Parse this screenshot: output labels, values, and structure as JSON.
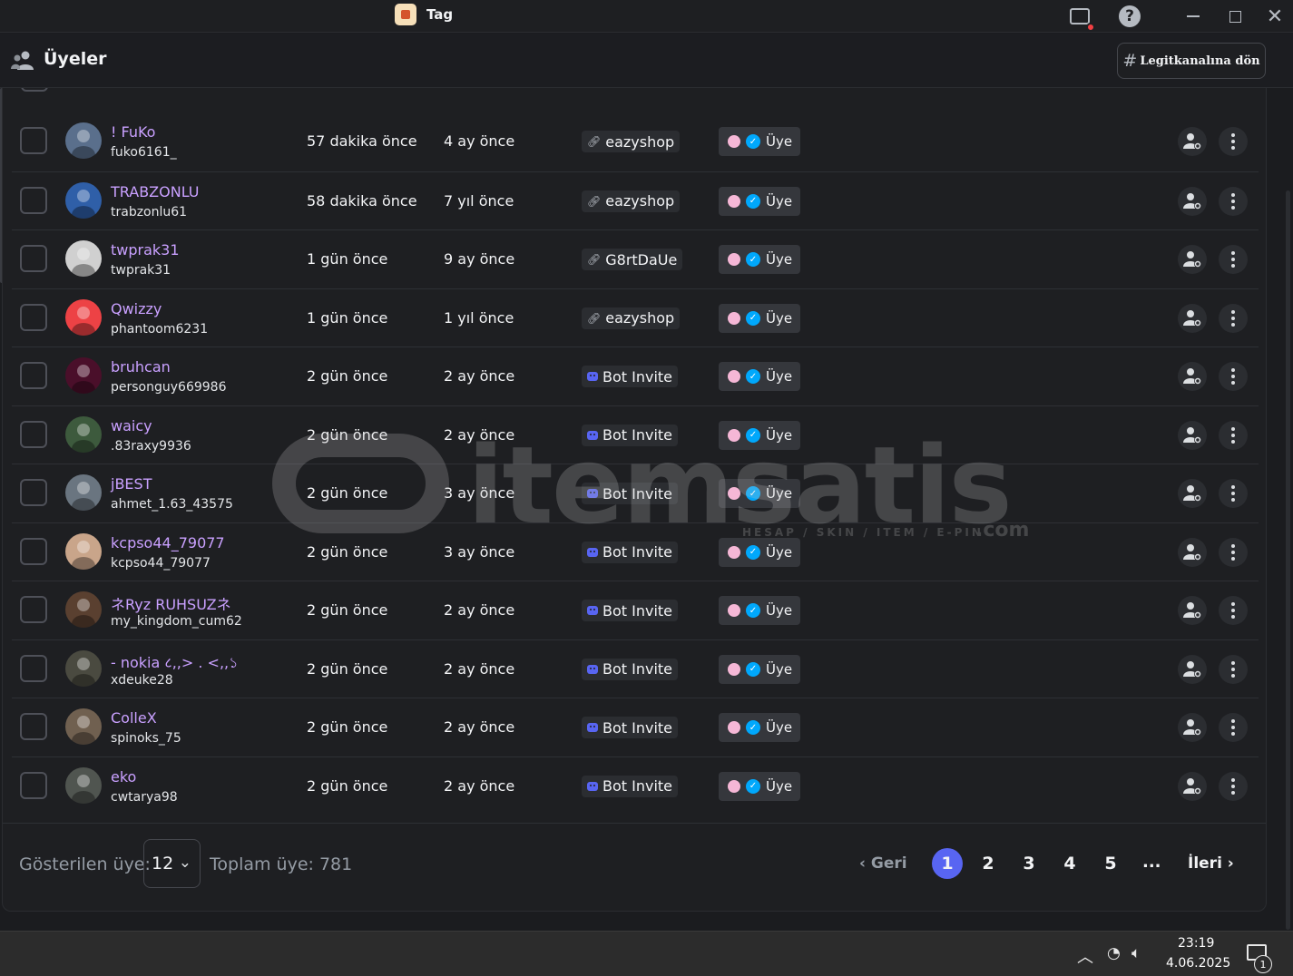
{
  "titlebar": {
    "app_title": "Tag",
    "icons": [
      "app-icon",
      "inbox-icon",
      "help-icon",
      "minimize-icon",
      "maximize-icon",
      "close-icon"
    ]
  },
  "header": {
    "title": "Üyeler",
    "icon": "members-icon",
    "back_button_hash": "#",
    "back_button_label": "Legitkanalına dön"
  },
  "table": {
    "rows": [
      {
        "display_name": "! FuKo",
        "username": "fuko6161_",
        "joined": "57 dakika önce",
        "account_age": "4 ay önce",
        "method": "eazyshop",
        "method_type": "link",
        "role": "Üye",
        "avatar_color": "#5a6f8c"
      },
      {
        "display_name": "TRABZONLU",
        "username": "trabzonlu61",
        "joined": "58 dakika önce",
        "account_age": "7 yıl önce",
        "method": "eazyshop",
        "method_type": "link",
        "role": "Üye",
        "avatar_color": "#2f5fa8"
      },
      {
        "display_name": "twprak31",
        "username": "twprak31",
        "joined": "1 gün önce",
        "account_age": "9 ay önce",
        "method": "G8rtDaUe",
        "method_type": "link",
        "role": "Üye",
        "avatar_color": "#d0d0d0"
      },
      {
        "display_name": "Qwizzy",
        "username": "phantoom6231",
        "joined": "1 gün önce",
        "account_age": "1 yıl önce",
        "method": "eazyshop",
        "method_type": "link",
        "role": "Üye",
        "avatar_color": "#ed4245"
      },
      {
        "display_name": "bruhcan",
        "username": "personguy669986",
        "joined": "2 gün önce",
        "account_age": "2 ay önce",
        "method": "Bot Invite",
        "method_type": "bot",
        "role": "Üye",
        "avatar_color": "#4a0f2a"
      },
      {
        "display_name": "waicy",
        "username": ".83raxy9936",
        "joined": "2 gün önce",
        "account_age": "2 ay önce",
        "method": "Bot Invite",
        "method_type": "bot",
        "role": "Üye",
        "avatar_color": "#3d5a3d"
      },
      {
        "display_name": "jBEST",
        "username": "ahmet_1.63_43575",
        "joined": "2 gün önce",
        "account_age": "3 ay önce",
        "method": "Bot Invite",
        "method_type": "bot",
        "role": "Üye",
        "avatar_color": "#6a7580"
      },
      {
        "display_name": "kcpso44_79077",
        "username": "kcpso44_79077",
        "joined": "2 gün önce",
        "account_age": "3 ay önce",
        "method": "Bot Invite",
        "method_type": "bot",
        "role": "Üye",
        "avatar_color": "#c9a58a"
      },
      {
        "display_name": "ネRyz RUHSUZネ",
        "username": "my_kingdom_cum62",
        "joined": "2 gün önce",
        "account_age": "2 ay önce",
        "method": "Bot Invite",
        "method_type": "bot",
        "role": "Üye",
        "avatar_color": "#5a4030"
      },
      {
        "display_name": "- nokia ८,,> . <,,১",
        "username": "xdeuke28",
        "joined": "2 gün önce",
        "account_age": "2 ay önce",
        "method": "Bot Invite",
        "method_type": "bot",
        "role": "Üye",
        "avatar_color": "#4a4a40"
      },
      {
        "display_name": "ColleX",
        "username": "spinoks_75",
        "joined": "2 gün önce",
        "account_age": "2 ay önce",
        "method": "Bot Invite",
        "method_type": "bot",
        "role": "Üye",
        "avatar_color": "#706050"
      },
      {
        "display_name": "eko",
        "username": "cwtarya98",
        "joined": "2 gün önce",
        "account_age": "2 ay önce",
        "method": "Bot Invite",
        "method_type": "bot",
        "role": "Üye",
        "avatar_color": "#505550"
      }
    ]
  },
  "footer": {
    "shown_label": "Gösterilen üye:",
    "page_size": "12",
    "total_label": "Toplam üye: 781",
    "prev_label": "‹  Geri",
    "pages": [
      "1",
      "2",
      "3",
      "4",
      "5"
    ],
    "active_page": "1",
    "ellipsis": "...",
    "next_label": "İleri  ›"
  },
  "watermark": {
    "text": "itemsatis",
    "subtitle": "HESAP / SKIN / ITEM / E-PIN",
    "suffix": ".com"
  },
  "taskbar": {
    "time": "23:19",
    "date": "4.06.2025",
    "notification_count": "1",
    "icons": [
      "tray-chevron-icon",
      "network-icon",
      "volume-icon",
      "notification-icon"
    ]
  },
  "colors": {
    "accent": "#5865f2",
    "name": "#c9a0ff",
    "verified": "#00a8fc",
    "role_dot": "#f5b7d6"
  }
}
